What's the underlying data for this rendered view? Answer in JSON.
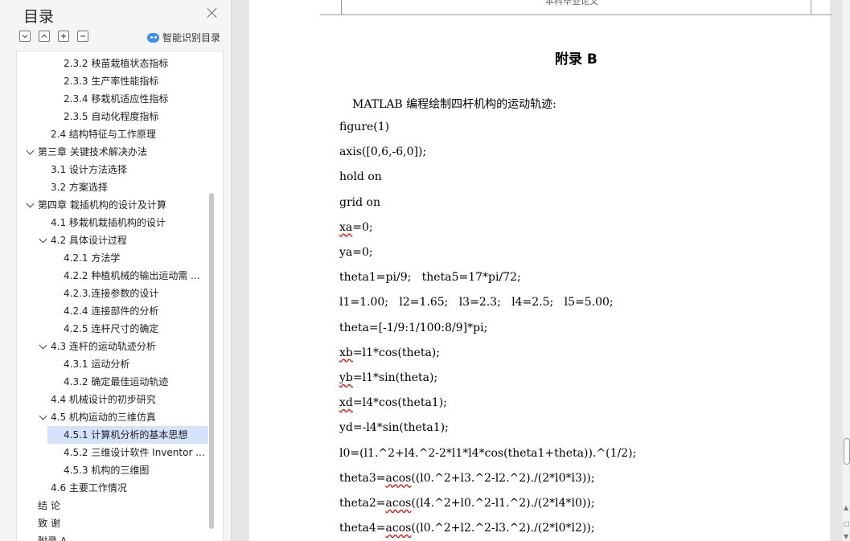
{
  "sidebar": {
    "title": "目录",
    "smart_label": "智能识别目录",
    "items": [
      {
        "label": "2.3.2 秧苗栽植状态指标"
      },
      {
        "label": "2.3.3  生产率性能指标"
      },
      {
        "label": "2.3.4 移栽机适应性指标"
      },
      {
        "label": "2.3.5 自动化程度指标"
      },
      {
        "label": "2.4  结构特征与工作原理"
      },
      {
        "label": "第三章  关键技术解决办法"
      },
      {
        "label": "3.1  设计方法选择"
      },
      {
        "label": "3.2  方案选择"
      },
      {
        "label": "第四章  栽插机构的设计及计算"
      },
      {
        "label": "4.1  移栽机栽插机构的设计"
      },
      {
        "label": "4.2  具体设计过程"
      },
      {
        "label": "4.2.1  方法学"
      },
      {
        "label": "4.2.2  种植机械的输出运动需 ..."
      },
      {
        "label": "4.2.3.连接参数的设计"
      },
      {
        "label": "4.2.4  连接部件的分析"
      },
      {
        "label": "4.2.5  连杆尺寸的确定"
      },
      {
        "label": "4.3  连杆的运动轨迹分析"
      },
      {
        "label": "4.3.1  运动分析"
      },
      {
        "label": "4.3.2  确定最佳运动轨迹"
      },
      {
        "label": "4.4  机械设计的初步研究"
      },
      {
        "label": "4.5  机构运动的三维仿真"
      },
      {
        "label": "4.5.1  计算机分析的基本思想"
      },
      {
        "label": "4.5.2  三维设计软件 Inventor ..."
      },
      {
        "label": "4.5.3    机构的三维图"
      },
      {
        "label": "4.6  主要工作情况"
      },
      {
        "label": "结    论"
      },
      {
        "label": "致    谢"
      },
      {
        "label": "附录 A"
      }
    ]
  },
  "document": {
    "header_text": "本科毕业论文",
    "appendix_title": "附录 B",
    "intro": "MATLAB 编程绘制四杆机构的运动轨迹:",
    "code_lines": [
      [
        {
          "t": "figure(1)"
        }
      ],
      [
        {
          "t": "axis([0,6,-6,0]);"
        }
      ],
      [
        {
          "t": "hold on"
        }
      ],
      [
        {
          "t": "grid on"
        }
      ],
      [
        {
          "t": "xa",
          "sq": true
        },
        {
          "t": "=0;"
        }
      ],
      [
        {
          "t": "ya=0;"
        }
      ],
      [
        {
          "t": "theta1=pi/9;   theta5=17*pi/72;"
        }
      ],
      [
        {
          "t": "l1=1.00;   l2=1.65;   l3=2.3;   l4=2.5;   l5=5.00;"
        }
      ],
      [
        {
          "t": "theta=[-1/9:1/100:8/9]*pi;"
        }
      ],
      [
        {
          "t": "xb",
          "sq": true
        },
        {
          "t": "=l1*cos(theta);"
        }
      ],
      [
        {
          "t": "yb",
          "sq": true
        },
        {
          "t": "=l1*sin(theta);"
        }
      ],
      [
        {
          "t": "xd",
          "sq": true
        },
        {
          "t": "=l4*cos(theta1);"
        }
      ],
      [
        {
          "t": "yd=-l4*sin(theta1);"
        }
      ],
      [
        {
          "t": "l0=(l1.^2+l4.^2-2*l1*l4*cos(theta1+theta)).^(1/2);"
        }
      ],
      [
        {
          "t": "theta3="
        },
        {
          "t": "acos",
          "sq": true
        },
        {
          "t": "((l0.^2+l3.^2-l2.^2)./(2*l0*l3));"
        }
      ],
      [
        {
          "t": "theta2="
        },
        {
          "t": "acos",
          "sq": true
        },
        {
          "t": "((l4.^2+l0.^2-l1.^2)./(2*l4*l0));"
        }
      ],
      [
        {
          "t": "theta4="
        },
        {
          "t": "acos",
          "sq": true
        },
        {
          "t": "((l0.^2+l2.^2-l3.^2)./(2*l0*l2));"
        }
      ]
    ]
  }
}
